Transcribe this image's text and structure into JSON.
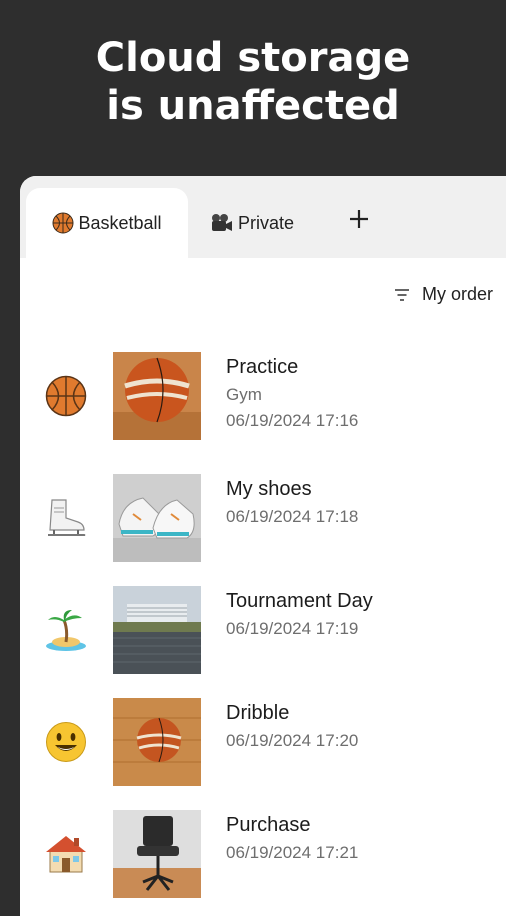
{
  "headline": {
    "line1": "Cloud storage",
    "line2": "is unaffected"
  },
  "tabs": [
    {
      "label": "Basketball",
      "icon": "basketball-icon",
      "active": true
    },
    {
      "label": "Private",
      "icon": "video-camera-icon",
      "active": false
    }
  ],
  "add_tab": {
    "icon": "plus-icon"
  },
  "sort": {
    "label": "My order",
    "icon": "sort-filter-icon"
  },
  "items": [
    {
      "icon": "basketball-icon",
      "title": "Practice",
      "subtitle": "Gym",
      "date": "06/19/2024 17:16"
    },
    {
      "icon": "ice-skate-icon",
      "title": "My shoes",
      "subtitle": "",
      "date": "06/19/2024 17:18"
    },
    {
      "icon": "desert-island-icon",
      "title": "Tournament Day",
      "subtitle": "",
      "date": "06/19/2024 17:19"
    },
    {
      "icon": "smiley-face-icon",
      "title": "Dribble",
      "subtitle": "",
      "date": "06/19/2024 17:20"
    },
    {
      "icon": "house-icon",
      "title": "Purchase",
      "subtitle": "",
      "date": "06/19/2024 17:21"
    }
  ],
  "colors": {
    "background": "#2e2e2e",
    "panel": "#ffffff",
    "tabbar": "#f0f0f0",
    "basketball": "#e07a2e"
  }
}
